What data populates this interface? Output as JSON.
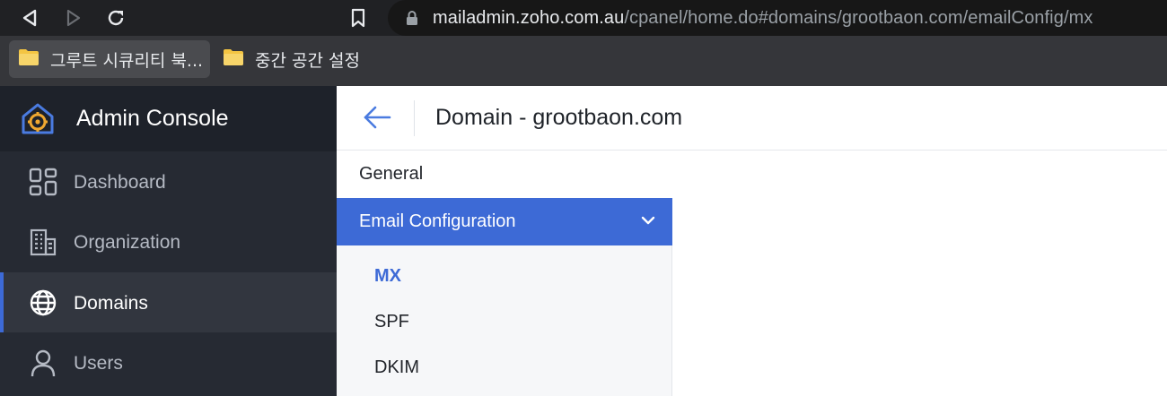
{
  "browser": {
    "url_host": "mailadmin.zoho.com.au",
    "url_path": "/cpanel/home.do#domains/grootbaon.com/emailConfig/mx",
    "bookmarks": [
      {
        "label": "그루트 시큐리티 북...",
        "icon": "folder-icon"
      },
      {
        "label": "중간 공간 설정",
        "icon": "folder-icon"
      }
    ],
    "icons": [
      "back-arrow-icon",
      "forward-arrow-icon",
      "reload-icon",
      "bookmark-icon",
      "lock-icon"
    ]
  },
  "sidebar": {
    "brand": "Admin Console",
    "items": [
      {
        "label": "Dashboard",
        "icon": "dashboard-icon"
      },
      {
        "label": "Organization",
        "icon": "building-icon"
      },
      {
        "label": "Domains",
        "icon": "globe-icon",
        "active": true
      },
      {
        "label": "Users",
        "icon": "user-icon"
      }
    ]
  },
  "header": {
    "title": "Domain - grootbaon.com"
  },
  "subnav": {
    "general": "General",
    "email_config": "Email Configuration",
    "email_items": [
      {
        "label": "MX",
        "current": true
      },
      {
        "label": "SPF"
      },
      {
        "label": "DKIM"
      }
    ]
  },
  "colors": {
    "accent": "#3d6ad6",
    "sidebar_bg": "#262a33",
    "chrome_bg": "#202124"
  }
}
